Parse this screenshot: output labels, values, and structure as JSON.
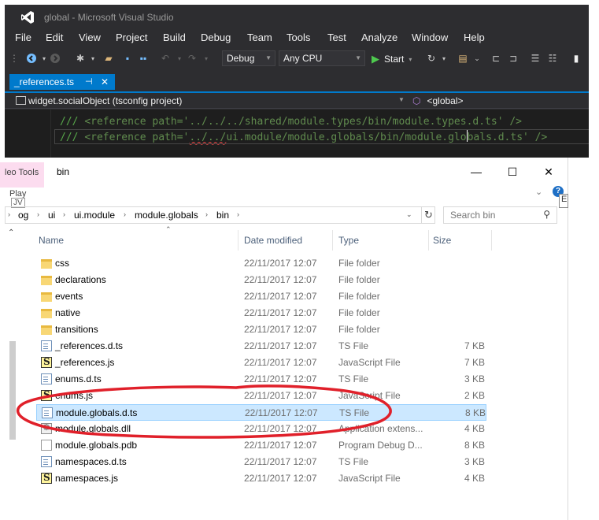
{
  "vs": {
    "title": "global - Microsoft Visual Studio",
    "menu": [
      "File",
      "Edit",
      "View",
      "Project",
      "Build",
      "Debug",
      "Team",
      "Tools",
      "Test",
      "Analyze",
      "Window",
      "Help"
    ],
    "toolbar": {
      "config": "Debug",
      "platform": "Any CPU",
      "start": "Start"
    },
    "tab": {
      "label": "_references.ts",
      "pin": "⊣",
      "close": "✕"
    },
    "navbar": {
      "project": "widget.socialObject (tsconfig project)",
      "scope": "<global>"
    },
    "code": {
      "line1_prefix": "/// ",
      "line1_tag": "<reference path='../../../shared/module.types/bin/module.types.d.ts' />",
      "line2_prefix": "/// ",
      "line2_a": "<reference path='",
      "line2_sq": "../../",
      "line2_b": "ui.module/module.globals/bin/module.glo",
      "line2_c": "bals.d.ts' />"
    }
  },
  "explorer": {
    "ribbon_tab": "leo Tools",
    "ribbon_sub": "Play",
    "ribbon_sub2": "JV",
    "window_title": "bin",
    "window_buttons": {
      "minimize": "—",
      "maximize": "☐",
      "close": "✕"
    },
    "help": "?",
    "edge_label": "E",
    "breadcrumb": [
      "og",
      "ui",
      "ui.module",
      "module.globals",
      "bin"
    ],
    "search_placeholder": "Search bin",
    "columns": {
      "name": "Name",
      "date": "Date modified",
      "type": "Type",
      "size": "Size"
    },
    "files": [
      {
        "name": "css",
        "date": "22/11/2017 12:07",
        "type": "File folder",
        "size": "",
        "icon": "folder"
      },
      {
        "name": "declarations",
        "date": "22/11/2017 12:07",
        "type": "File folder",
        "size": "",
        "icon": "folder"
      },
      {
        "name": "events",
        "date": "22/11/2017 12:07",
        "type": "File folder",
        "size": "",
        "icon": "folder"
      },
      {
        "name": "native",
        "date": "22/11/2017 12:07",
        "type": "File folder",
        "size": "",
        "icon": "folder"
      },
      {
        "name": "transitions",
        "date": "22/11/2017 12:07",
        "type": "File folder",
        "size": "",
        "icon": "folder"
      },
      {
        "name": "_references.d.ts",
        "date": "22/11/2017 12:07",
        "type": "TS File",
        "size": "7 KB",
        "icon": "ts"
      },
      {
        "name": "_references.js",
        "date": "22/11/2017 12:07",
        "type": "JavaScript File",
        "size": "7 KB",
        "icon": "js"
      },
      {
        "name": "enums.d.ts",
        "date": "22/11/2017 12:07",
        "type": "TS File",
        "size": "3 KB",
        "icon": "ts"
      },
      {
        "name": "enums.js",
        "date": "22/11/2017 12:07",
        "type": "JavaScript File",
        "size": "2 KB",
        "icon": "js"
      },
      {
        "name": "module.globals.d.ts",
        "date": "22/11/2017 12:07",
        "type": "TS File",
        "size": "8 KB",
        "icon": "ts",
        "selected": true
      },
      {
        "name": "module.globals.dll",
        "date": "22/11/2017 12:07",
        "type": "Application extens...",
        "size": "4 KB",
        "icon": "dll"
      },
      {
        "name": "module.globals.pdb",
        "date": "22/11/2017 12:07",
        "type": "Program Debug D...",
        "size": "8 KB",
        "icon": "pdb"
      },
      {
        "name": "namespaces.d.ts",
        "date": "22/11/2017 12:07",
        "type": "TS File",
        "size": "3 KB",
        "icon": "ts"
      },
      {
        "name": "namespaces.js",
        "date": "22/11/2017 12:07",
        "type": "JavaScript File",
        "size": "4 KB",
        "icon": "js"
      }
    ]
  },
  "colors": {
    "vs_background": "#2d2d30",
    "vs_accent": "#007acc",
    "editor_background": "#1e1e1e",
    "comment_green": "#57a64a",
    "selection_fill": "#cce8ff",
    "annotation_red": "#e0202a"
  }
}
